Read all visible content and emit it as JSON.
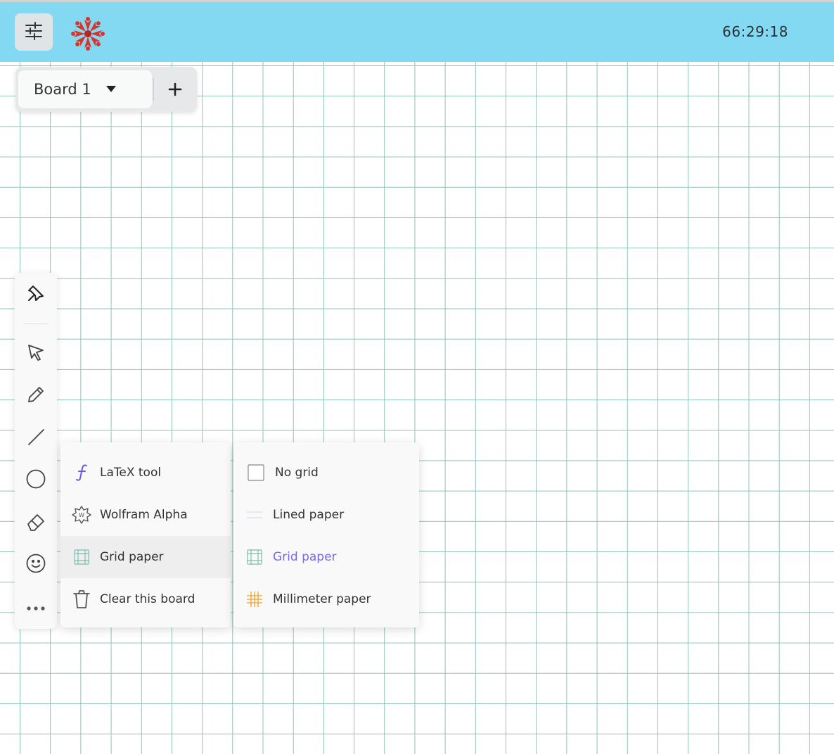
{
  "header": {
    "timer": "66:29:18",
    "settings_icon": "sliders-icon",
    "logo_icon": "snowflake-logo",
    "background_color": "#83d9f2"
  },
  "boards": {
    "current": "Board 1",
    "add_icon": "plus-icon"
  },
  "toolbar": {
    "tools": [
      {
        "name": "pin",
        "icon": "pin-icon"
      },
      {
        "name": "select",
        "icon": "cursor-icon"
      },
      {
        "name": "pen",
        "icon": "pencil-icon"
      },
      {
        "name": "line",
        "icon": "line-icon"
      },
      {
        "name": "circle",
        "icon": "circle-icon"
      },
      {
        "name": "eraser",
        "icon": "eraser-icon"
      },
      {
        "name": "emoji",
        "icon": "smiley-icon"
      },
      {
        "name": "more",
        "icon": "more-icon"
      }
    ]
  },
  "menu": {
    "items": [
      {
        "label": "LaTeX tool",
        "icon": "latex-icon"
      },
      {
        "label": "Wolfram Alpha",
        "icon": "wolfram-icon"
      },
      {
        "label": "Grid paper",
        "icon": "grid-icon",
        "active": true
      },
      {
        "label": "Clear this board",
        "icon": "trash-icon"
      }
    ]
  },
  "submenu": {
    "items": [
      {
        "label": "No grid",
        "icon": "empty-box-icon"
      },
      {
        "label": "Lined paper",
        "icon": "lines-icon"
      },
      {
        "label": "Grid paper",
        "icon": "grid-icon",
        "selected": true
      },
      {
        "label": "Millimeter paper",
        "icon": "millimeter-icon"
      }
    ],
    "selected_color": "#7b68ee",
    "grid_color": "#8fc4b8",
    "millimeter_color": "#f0a030"
  }
}
